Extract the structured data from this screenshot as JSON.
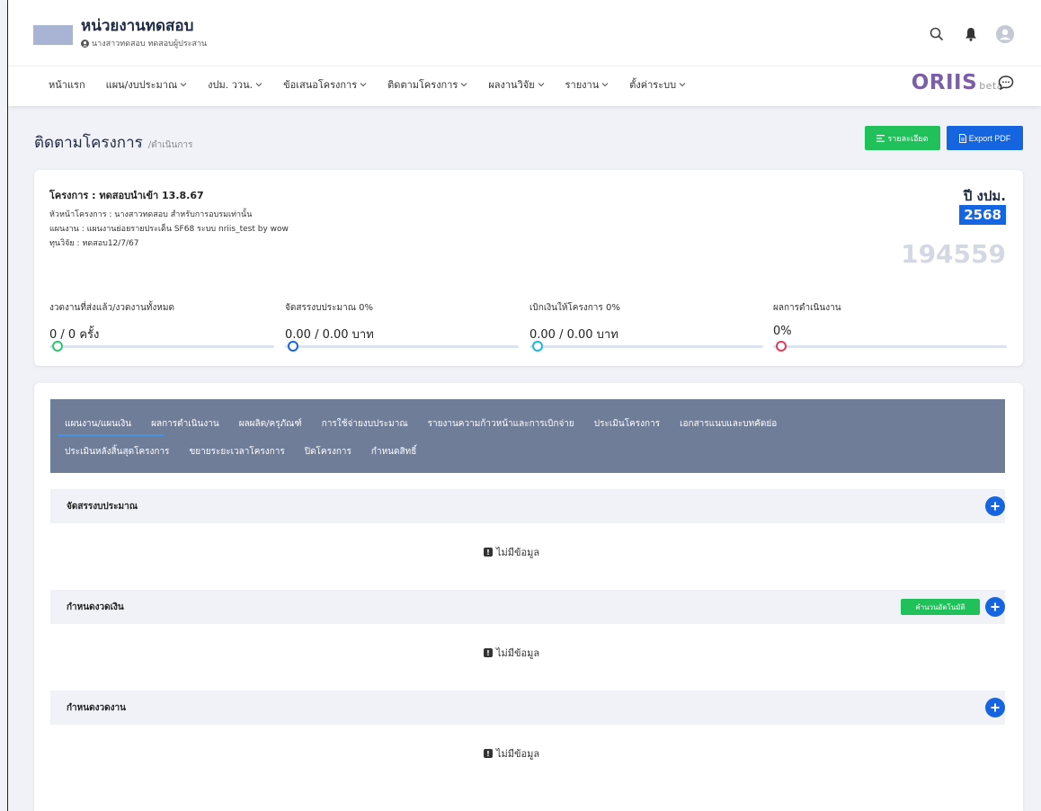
{
  "header": {
    "org_title": "หน่วยงานทดสอบ",
    "user_line": "นางสาวทดสอบ ทดสอบผู้ประสาน"
  },
  "nav": {
    "items": [
      {
        "label": "หน้าแรก"
      },
      {
        "label": "แผน/งบประมาณ"
      },
      {
        "label": "งปม. ววน."
      },
      {
        "label": "ข้อเสนอโครงการ"
      },
      {
        "label": "ติดตามโครงการ"
      },
      {
        "label": "ผลงานวิจัย"
      },
      {
        "label": "รายงาน"
      },
      {
        "label": "ตั้งค่าระบบ"
      }
    ],
    "brand_main": "ORIIS",
    "brand_beta": "beta"
  },
  "page": {
    "title": "ติดตามโครงการ",
    "subtitle": "/ดำเนินการ",
    "detail_button": "รายละเอียด",
    "export_button": "Export PDF"
  },
  "project": {
    "name": "โครงการ : ทดสอบนำเข้า 13.8.67",
    "leader": "หัวหน้าโครงการ : นางสาวทดสอบ สำหรับการอบรมเท่านั้น",
    "plan": "แผนงาน : แผนงานย่อยรายประเด็น SF68 ระบบ nriis_test by wow",
    "fund": "ทุนวิจัย : ทดสอบ12/7/67",
    "year_label": "ปี งปม.",
    "year": "2568",
    "project_id": "194559"
  },
  "stats": [
    {
      "label": "งวดงานที่ส่งแล้ว/งวดงานทั้งหมด",
      "value": "0 / 0 ครั้ง",
      "progress": 0,
      "color": "#28c76f"
    },
    {
      "label": "จัดสรรงบประมาณ 0%",
      "value": "0.00 / 0.00 บาท",
      "progress": 0,
      "color": "#1565e0"
    },
    {
      "label": "เบิกเงินให้โครงการ 0%",
      "value": "0.00 / 0.00 บาท",
      "progress": 0,
      "color": "#17b8e8"
    },
    {
      "label": "ผลการดำเนินงาน",
      "value": "0%",
      "progress": 0,
      "color": "#e8385a"
    }
  ],
  "tabs": {
    "row1": [
      "แผนงาน/แผนเงิน",
      "ผลการดำเนินงาน",
      "ผลผลิต/ครุภัณฑ์",
      "การใช้จ่ายงบประมาณ",
      "รายงานความก้าวหน้าและการเบิกจ่าย",
      "ประเมินโครงการ",
      "เอกสารแนบและบทคัดย่อ"
    ],
    "row2": [
      "ประเมินหลังสิ้นสุดโครงการ",
      "ขยายระยะเวลาโครงการ",
      "ปิดโครงการ",
      "กำหนดสิทธิ์"
    ],
    "active": "แผนงาน/แผนเงิน"
  },
  "sections": [
    {
      "title": "จัดสรรงบประมาณ",
      "empty": "ไม่มีข้อมูล"
    },
    {
      "title": "กำหนดงวดเงิน",
      "empty": "ไม่มีข้อมูล",
      "auto_button": "คำนวนอัตโนมัติ"
    },
    {
      "title": "กำหนดงวดงาน",
      "empty": "ไม่มีข้อมูล"
    }
  ]
}
